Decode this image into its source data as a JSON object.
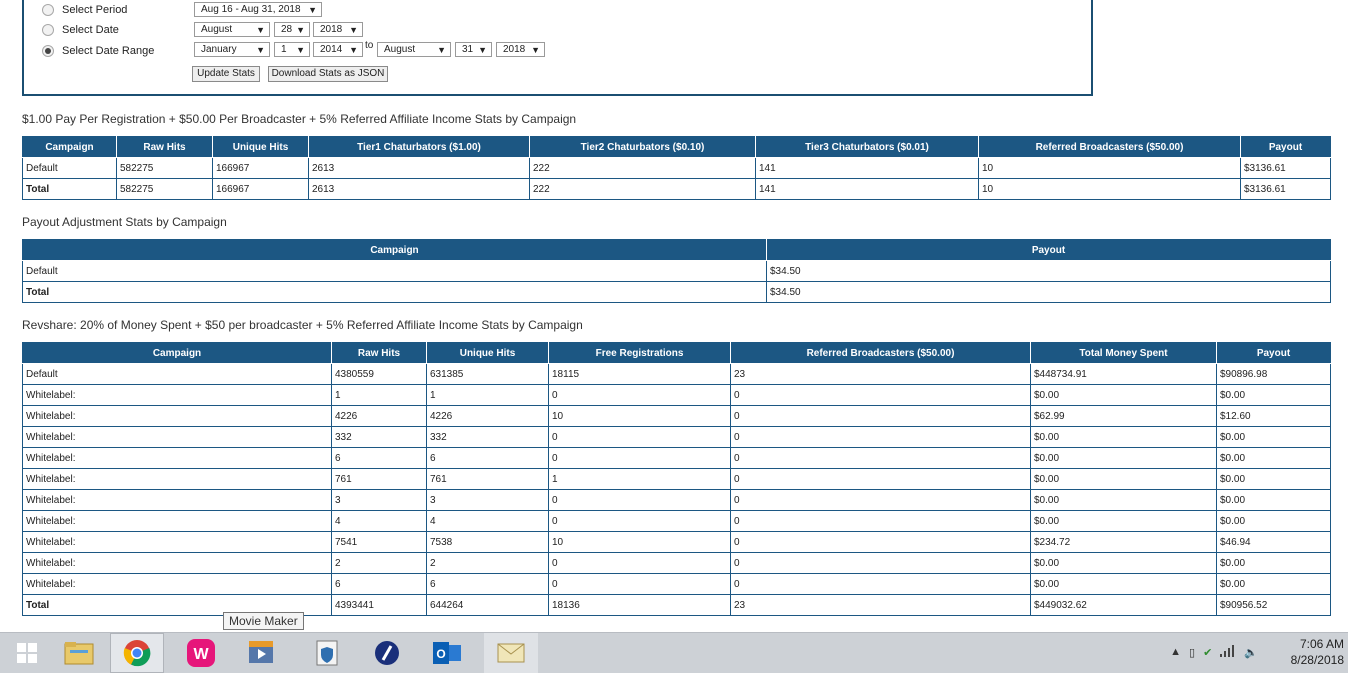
{
  "filters": {
    "period_label": "Select Period",
    "date_label": "Select Date",
    "range_label": "Select Date Range",
    "period_value": "Aug 16 - Aug 31, 2018",
    "date_month": "August",
    "date_day": "28",
    "date_year": "2018",
    "range_from_month": "January",
    "range_from_day": "1",
    "range_from_year": "2014",
    "to_label": "to",
    "range_to_month": "August",
    "range_to_day": "31",
    "range_to_year": "2018",
    "update_button": "Update Stats",
    "download_button": "Download Stats as JSON"
  },
  "section1": {
    "title": "$1.00 Pay Per Registration + $50.00 Per Broadcaster + 5% Referred Affiliate Income Stats by Campaign",
    "headers": [
      "Campaign",
      "Raw Hits",
      "Unique Hits",
      "Tier1 Chaturbators ($1.00)",
      "Tier2 Chaturbators ($0.10)",
      "Tier3 Chaturbators ($0.01)",
      "Referred Broadcasters ($50.00)",
      "Payout"
    ],
    "rows": [
      [
        "Default",
        "582275",
        "166967",
        "2613",
        "222",
        "141",
        "10",
        "$3136.61"
      ],
      [
        "Total",
        "582275",
        "166967",
        "2613",
        "222",
        "141",
        "10",
        "$3136.61"
      ]
    ]
  },
  "section2": {
    "title": "Payout Adjustment Stats by Campaign",
    "headers": [
      "Campaign",
      "Payout"
    ],
    "rows": [
      [
        "Default",
        "$34.50"
      ],
      [
        "Total",
        "$34.50"
      ]
    ]
  },
  "section3": {
    "title": "Revshare: 20% of Money Spent + $50 per broadcaster + 5% Referred Affiliate Income Stats by Campaign",
    "headers": [
      "Campaign",
      "Raw Hits",
      "Unique Hits",
      "Free Registrations",
      "Referred Broadcasters ($50.00)",
      "Total Money Spent",
      "Payout"
    ],
    "rows": [
      [
        "Default",
        "4380559",
        "631385",
        "18115",
        "23",
        "$448734.91",
        "$90896.98"
      ],
      [
        "Whitelabel:",
        "1",
        "1",
        "0",
        "0",
        "$0.00",
        "$0.00"
      ],
      [
        "Whitelabel:",
        "4226",
        "4226",
        "10",
        "0",
        "$62.99",
        "$12.60"
      ],
      [
        "Whitelabel:",
        "332",
        "332",
        "0",
        "0",
        "$0.00",
        "$0.00"
      ],
      [
        "Whitelabel:",
        "6",
        "6",
        "0",
        "0",
        "$0.00",
        "$0.00"
      ],
      [
        "Whitelabel:",
        "761",
        "761",
        "1",
        "0",
        "$0.00",
        "$0.00"
      ],
      [
        "Whitelabel:",
        "3",
        "3",
        "0",
        "0",
        "$0.00",
        "$0.00"
      ],
      [
        "Whitelabel:",
        "4",
        "4",
        "0",
        "0",
        "$0.00",
        "$0.00"
      ],
      [
        "Whitelabel:",
        "7541",
        "7538",
        "10",
        "0",
        "$234.72",
        "$46.94"
      ],
      [
        "Whitelabel:",
        "2",
        "2",
        "0",
        "0",
        "$0.00",
        "$0.00"
      ],
      [
        "Whitelabel:",
        "6",
        "6",
        "0",
        "0",
        "$0.00",
        "$0.00"
      ],
      [
        "Total",
        "4393441",
        "644264",
        "18136",
        "23",
        "$449032.62",
        "$90956.52"
      ]
    ]
  },
  "taskbar": {
    "tooltip": "Movie Maker",
    "clock_time": "7:06 AM",
    "clock_date": "8/28/2018",
    "icons": [
      "windows-start-icon",
      "file-explorer-icon",
      "chrome-icon",
      "wamp-server-icon",
      "movie-maker-icon",
      "vpn-shield-icon",
      "edit-pen-icon",
      "outlook-icon",
      "mail-envelope-icon"
    ]
  },
  "colors": {
    "header_bg": "#1c5783",
    "border": "#1c5783",
    "taskbar": "#cdd1d6"
  }
}
